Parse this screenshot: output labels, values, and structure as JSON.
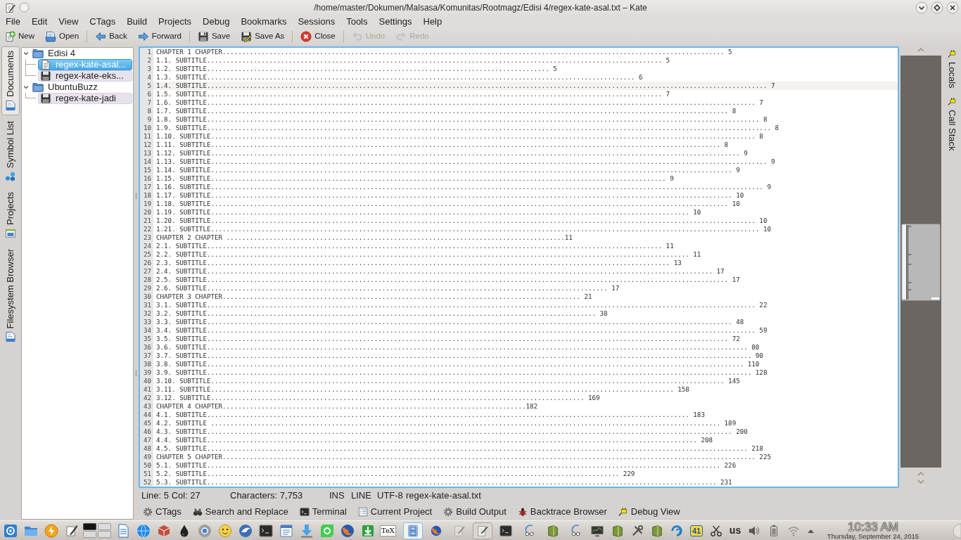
{
  "window": {
    "title": "/home/master/Dokumen/Malsasa/Komunitas/Rootmagz/Edisi 4/regex-kate-asal.txt – Kate"
  },
  "menu": [
    "File",
    "Edit",
    "View",
    "CTags",
    "Build",
    "Projects",
    "Debug",
    "Bookmarks",
    "Sessions",
    "Tools",
    "Settings",
    "Help"
  ],
  "toolbar": [
    [
      {
        "label": "New",
        "kind": "new",
        "disabled": false
      },
      {
        "label": "Open",
        "kind": "open",
        "disabled": false
      }
    ],
    [
      {
        "label": "Back",
        "kind": "back",
        "disabled": false
      },
      {
        "label": "Forward",
        "kind": "forward",
        "disabled": false
      }
    ],
    [
      {
        "label": "Save",
        "kind": "save",
        "disabled": false
      },
      {
        "label": "Save As",
        "kind": "saveas",
        "disabled": false
      }
    ],
    [
      {
        "label": "Close",
        "kind": "close",
        "disabled": false
      }
    ],
    [
      {
        "label": "Undo",
        "kind": "undo",
        "disabled": true
      },
      {
        "label": "Redo",
        "kind": "redo",
        "disabled": true
      }
    ]
  ],
  "left_tabs": [
    {
      "label": "Documents",
      "kind": "documents",
      "selected": true
    },
    {
      "label": "Symbol List",
      "kind": "symbols",
      "selected": false
    },
    {
      "label": "Projects",
      "kind": "projects",
      "selected": false
    },
    {
      "label": "Filesystem Browser",
      "kind": "filesystem",
      "selected": false
    }
  ],
  "documents": [
    {
      "name": "Edisi 4",
      "selected": false,
      "expanded": true,
      "children": [
        {
          "name": "regex-kate-asal...",
          "selected": true,
          "modified": false
        },
        {
          "name": "regex-kate-eks...",
          "selected": false,
          "modified": true
        }
      ]
    },
    {
      "name": "UbuntuBuzz",
      "selected": false,
      "expanded": true,
      "children": [
        {
          "name": "regex-kate-jadi",
          "selected": false,
          "modified": true
        }
      ]
    }
  ],
  "editor": {
    "lines": [
      {
        "number": "1",
        "text": "CHAPTER 1 CHAPTER................................................................................................................................. 5",
        "current": false
      },
      {
        "number": "2",
        "text": "1.1. SUBTITLE..................................................................................................................... 5",
        "current": false
      },
      {
        "number": "3",
        "text": "1.2. SUBTITLE........................................................................................ 5",
        "current": false
      },
      {
        "number": "4",
        "text": "1.3. SUBTITLE.............................................................................................................. 6",
        "current": false
      },
      {
        "number": "5",
        "text": "1.4. SUBTITLE................................................................................................................................................ 7",
        "current": true
      },
      {
        "number": "6",
        "text": "1.5. SUBTITLE..................................................................................................................... 7",
        "current": false
      },
      {
        "number": "7",
        "text": "1.6. SUBTITLE............................................................................................................................................. 7",
        "current": false
      },
      {
        "number": "8",
        "text": "1.7. SUBTITLE...................................................................................................................................... 8",
        "current": false
      },
      {
        "number": "9",
        "text": "1.8. SUBTITLE.............................................................................................................................................. 8",
        "current": false
      },
      {
        "number": "10",
        "text": "1.9. SUBTITLE................................................................................................................................................. 8",
        "current": false
      },
      {
        "number": "11",
        "text": "1.10. SUBTITLE............................................................................................................................................ 8",
        "current": false
      },
      {
        "number": "12",
        "text": "1.11. SUBTITLE................................................................................................................................... 8",
        "current": false
      },
      {
        "number": "13",
        "text": "1.12. SUBTITLE........................................................................................................................................ 9",
        "current": false
      },
      {
        "number": "14",
        "text": "1.13. SUBTITLE............................................................................................................................................... 9",
        "current": false
      },
      {
        "number": "15",
        "text": "1.14. SUBTITLE...................................................................................................................................... 9",
        "current": false
      },
      {
        "number": "16",
        "text": "1.15. SUBTITLE..................................................................................................................... 9",
        "current": false
      },
      {
        "number": "17",
        "text": "1.16. SUBTITLE.............................................................................................................................................. 9",
        "current": false
      },
      {
        "number": "18",
        "text": "1.17. SUBTITLE...................................................................................................................................... 10",
        "current": false
      },
      {
        "number": "19",
        "text": "1.18. SUBTITLE..................................................................................................................................... 10",
        "current": false
      },
      {
        "number": "20",
        "text": "1.19. SUBTITLE........................................................................................................................... 10",
        "current": false
      },
      {
        "number": "21",
        "text": "1.20. SUBTITLE............................................................................................................................................ 10",
        "current": false
      },
      {
        "number": "22",
        "text": "1.21. SUBTITLE............................................................................................................................................. 10",
        "current": false
      },
      {
        "number": "23",
        "text": "CHAPTER 2 CHAPTER .......................................................................................11",
        "current": false
      },
      {
        "number": "24",
        "text": "2.1. SUBTITLE..................................................................................................................... 11",
        "current": false
      },
      {
        "number": "25",
        "text": "2.2. SUBTITLE............................................................................................................................ 11",
        "current": false
      },
      {
        "number": "26",
        "text": "2.3. SUBTITLE....................................................................................................................... 13",
        "current": false
      },
      {
        "number": "27",
        "text": "2.4. SUBTITLE.................................................................................................................................. 17",
        "current": false
      },
      {
        "number": "28",
        "text": "2.5. SUBTITLE...................................................................................................................................... 17",
        "current": false
      },
      {
        "number": "29",
        "text": "2.6. SUBTITLE....................................................................................................... 17",
        "current": false
      },
      {
        "number": "30",
        "text": "CHAPTER 3 CHAPTER............................................................................................ 21",
        "current": false
      },
      {
        "number": "31",
        "text": "3.1. SUBTITLE............................................................................................................................................. 22",
        "current": false
      },
      {
        "number": "32",
        "text": "3.2. SUBTITLE.................................................................................................... 38",
        "current": false
      },
      {
        "number": "33",
        "text": "3.3. SUBTITLE....................................................................................................................................... 48",
        "current": false
      },
      {
        "number": "34",
        "text": "3.4. SUBTITLE............................................................................................................................................. 59",
        "current": false
      },
      {
        "number": "35",
        "text": "3.5. SUBTITLE...................................................................................................................................... 72",
        "current": false
      },
      {
        "number": "36",
        "text": "3.6. SUBTITLE........................................................................................................................................... 80",
        "current": false
      },
      {
        "number": "37",
        "text": "3.7. SUBTITLE............................................................................................................................................ 90",
        "current": false
      },
      {
        "number": "38",
        "text": "3.8. SUBTITLE.......................................................................................................................................... 110",
        "current": false
      },
      {
        "number": "39",
        "text": "3.9. SUBTITLE............................................................................................................................................ 128",
        "current": false
      },
      {
        "number": "40",
        "text": "3.10. SUBTITLE.................................................................................................................................... 145",
        "current": false
      },
      {
        "number": "41",
        "text": "3.11. SUBTITLE....................................................................................................................... 158",
        "current": false
      },
      {
        "number": "42",
        "text": "3.12. SUBTITLE................................................................................................ 169",
        "current": false
      },
      {
        "number": "43",
        "text": "CHAPTER 4 CHAPTER..............................................................................182",
        "current": false
      },
      {
        "number": "44",
        "text": "4.1. SUBTITLE............................................................................................................................ 183",
        "current": false
      },
      {
        "number": "45",
        "text": "4.2. SUBTITLE ................................................................................................................................... 189",
        "current": false
      },
      {
        "number": "46",
        "text": "4.3. SUBTITLE....................................................................................................................................... 200",
        "current": false
      },
      {
        "number": "47",
        "text": "4.4. SUBTITLE.............................................................................................................................. 208",
        "current": false
      },
      {
        "number": "48",
        "text": "4.5. SUBTITLE........................................................................................................................................... 218",
        "current": false
      },
      {
        "number": "49",
        "text": "CHAPTER 5 CHAPTER......................................................................................................................................... 225",
        "current": false
      },
      {
        "number": "50",
        "text": "5.1. SUBTITLE.................................................................................................................................... 226",
        "current": false
      },
      {
        "number": "51",
        "text": "5.2. SUBTITLE.......................................................................................................... 229",
        "current": false
      },
      {
        "number": "52",
        "text": "5.3. SUBTITLE................................................................................................................................... 231",
        "current": false
      }
    ]
  },
  "right_tabs": [
    {
      "label": "Locals",
      "selected": false
    },
    {
      "label": "Call Stack",
      "selected": false
    }
  ],
  "status_bar": {
    "position": "Line: 5 Col: 27",
    "characters": "Characters: 7,753",
    "input_mode": "INS",
    "selection_mode": "LINE",
    "encoding": "UTF-8",
    "file_name": "regex-kate-asal.txt"
  },
  "tool_tabs": [
    {
      "label": "CTags",
      "kind": "ctags",
      "selected": false
    },
    {
      "label": "Search and Replace",
      "kind": "search",
      "selected": false
    },
    {
      "label": "Terminal",
      "kind": "terminal",
      "selected": false
    },
    {
      "label": "Current Project",
      "kind": "project",
      "selected": false
    },
    {
      "label": "Build Output",
      "kind": "build",
      "selected": false
    },
    {
      "label": "Backtrace Browser",
      "kind": "backtrace",
      "selected": false
    },
    {
      "label": "Debug View",
      "kind": "debug",
      "selected": false
    }
  ],
  "taskbar": {
    "tex_launcher_label": "TeX",
    "tasks": [
      {
        "kind": "cabinet",
        "selected": true,
        "minimized": false,
        "highlighted": false
      },
      {
        "kind": "fox",
        "selected": false,
        "minimized": false,
        "highlighted": false
      },
      {
        "kind": "notepad",
        "selected": false,
        "minimized": true,
        "highlighted": false
      },
      {
        "kind": "notepad",
        "selected": false,
        "minimized": false,
        "highlighted": true
      }
    ],
    "tray_badge": "41",
    "keyboard_layout": "us",
    "time": "10:33 AM",
    "date": "Thursday, September 24, 2015"
  }
}
